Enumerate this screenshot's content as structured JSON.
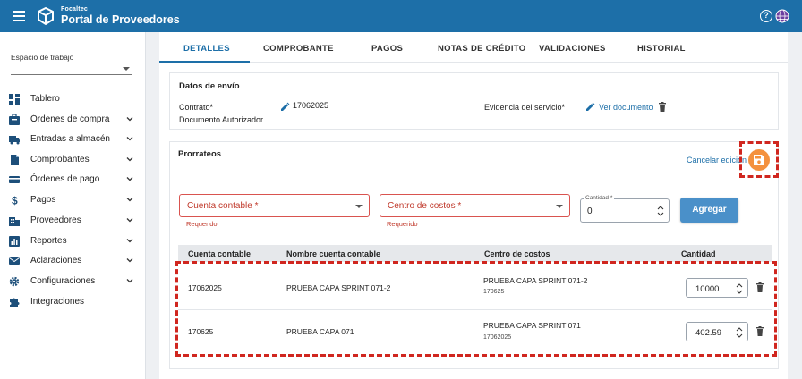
{
  "app": {
    "brand_small": "Focaltec",
    "brand_title": "Portal de Proveedores"
  },
  "sidebar": {
    "workspace_label": "Espacio de trabajo",
    "items": [
      {
        "label": "Tablero",
        "icon": "dashboard-icon"
      },
      {
        "label": "Órdenes de compra",
        "icon": "purchase-order-icon"
      },
      {
        "label": "Entradas a almacén",
        "icon": "truck-icon"
      },
      {
        "label": "Comprobantes",
        "icon": "document-icon"
      },
      {
        "label": "Órdenes de pago",
        "icon": "credit-card-icon"
      },
      {
        "label": "Pagos",
        "icon": "money-icon"
      },
      {
        "label": "Proveedores",
        "icon": "building-icon"
      },
      {
        "label": "Reportes",
        "icon": "chart-icon"
      },
      {
        "label": "Aclaraciones",
        "icon": "mail-icon"
      },
      {
        "label": "Configuraciones",
        "icon": "gear-icon"
      },
      {
        "label": "Integraciones",
        "icon": "puzzle-icon"
      }
    ]
  },
  "tabs": [
    "DETALLES",
    "COMPROBANTE",
    "PAGOS",
    "NOTAS DE CRÉDITO",
    "VALIDACIONES",
    "HISTORIAL"
  ],
  "envio": {
    "title": "Datos de envío",
    "contrato_label": "Contrato*",
    "contrato_value": "17062025",
    "doc_autorizador_label": "Documento Autorizador",
    "evidencia_label": "Evidencia del servicio*",
    "ver_documento": "Ver documento"
  },
  "prorrateos": {
    "title": "Prorrateos",
    "cancel_label": "Cancelar edición",
    "cuenta_placeholder": "Cuenta contable *",
    "centro_placeholder": "Centro de costos *",
    "requerido": "Requerido",
    "cantidad_label": "Cantidad *",
    "cantidad_value": "0",
    "agregar_label": "Agregar"
  },
  "table": {
    "headers": [
      "Cuenta contable",
      "Nombre cuenta contable",
      "Centro de costos",
      "Cantidad"
    ],
    "rows": [
      {
        "cuenta": "17062025",
        "nombre": "PRUEBA CAPA SPRINT 071-2",
        "centro": "PRUEBA CAPA SPRINT 071-2",
        "centro_code": "170625",
        "cantidad": "10000"
      },
      {
        "cuenta": "170625",
        "nombre": "PRUEBA CAPA 071",
        "centro": "PRUEBA CAPA SPRINT 071",
        "centro_code": "17062025",
        "cantidad": "402.59"
      }
    ]
  },
  "colors": {
    "primary": "#1d6fa8",
    "button": "#4a90c9",
    "save_fab": "#f4913e",
    "error": "#d9534f",
    "highlight": "#d0261f"
  }
}
